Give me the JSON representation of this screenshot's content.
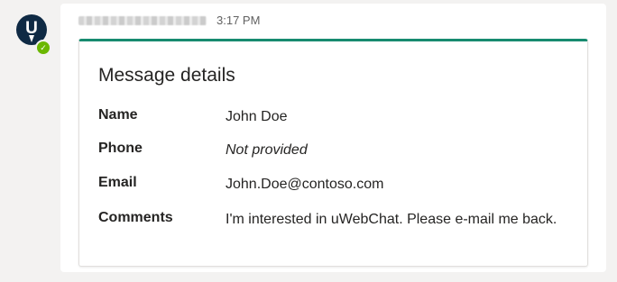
{
  "message": {
    "sender": "",
    "time": "3:17 PM",
    "card": {
      "title": "Message details",
      "fields": [
        {
          "label": "Name",
          "value": "John Doe"
        },
        {
          "label": "Phone",
          "value": "Not provided"
        },
        {
          "label": "Email",
          "value": "John.Doe@contoso.com"
        },
        {
          "label": "Comments",
          "value": "I'm interested in uWebChat. Please e-mail me back."
        }
      ]
    }
  },
  "avatar": {
    "letter": "U",
    "icon": "bot-avatar-icon",
    "presence_icon": "checkmark-icon"
  },
  "colors": {
    "accent": "#178b6f",
    "presence": "#6bb700",
    "avatar_bg": "#0f2a44"
  }
}
